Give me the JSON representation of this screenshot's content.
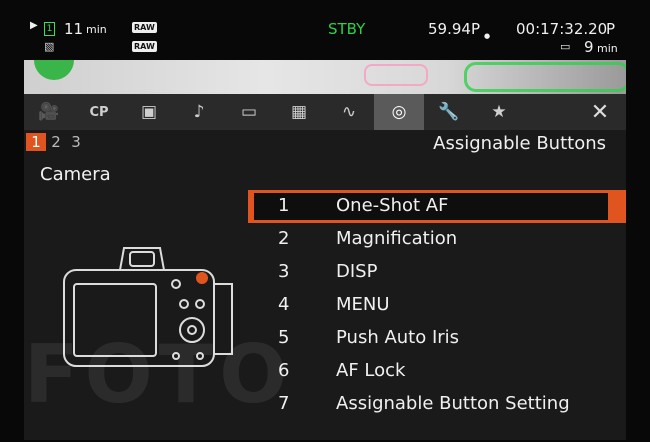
{
  "status": {
    "rec_time": "11",
    "rec_unit": "min",
    "raw_top": "RAW",
    "raw_bottom": "RAW",
    "card": "1",
    "mode": "STBY",
    "frame_rate": "59.94P",
    "timecode": "00:17:32.20",
    "timecode_flag": "P",
    "battery": "9",
    "battery_unit": "min",
    "accent": "#2fd04a"
  },
  "tabs": [
    {
      "icon": "movie-camera-icon",
      "glyph": "🎥"
    },
    {
      "icon": "cp-icon",
      "glyph": "CP"
    },
    {
      "icon": "camera-settings-icon",
      "glyph": "▣"
    },
    {
      "icon": "audio-icon",
      "glyph": "♪"
    },
    {
      "icon": "frame-icon",
      "glyph": "▭"
    },
    {
      "icon": "picture-style-icon",
      "glyph": "▦"
    },
    {
      "icon": "waveform-icon",
      "glyph": "∿"
    },
    {
      "icon": "custom-function-icon",
      "glyph": "◎"
    },
    {
      "icon": "wrench-icon",
      "glyph": "🔧"
    },
    {
      "icon": "star-icon",
      "glyph": "★"
    }
  ],
  "close_glyph": "✕",
  "pages": [
    "1",
    "2",
    "3"
  ],
  "active_page": "1",
  "title": "Assignable Buttons",
  "section": "Camera",
  "items": [
    {
      "num": "1",
      "label": "One-Shot AF"
    },
    {
      "num": "2",
      "label": "Magnification"
    },
    {
      "num": "3",
      "label": "DISP"
    },
    {
      "num": "4",
      "label": "MENU"
    },
    {
      "num": "5",
      "label": "Push Auto Iris"
    },
    {
      "num": "6",
      "label": "AF Lock"
    },
    {
      "num": "7",
      "label": "Assignable Button Setting"
    }
  ],
  "watermark": "FOTO",
  "colors": {
    "highlight": "#e0551f",
    "tab_active": "#5a5a5a"
  }
}
